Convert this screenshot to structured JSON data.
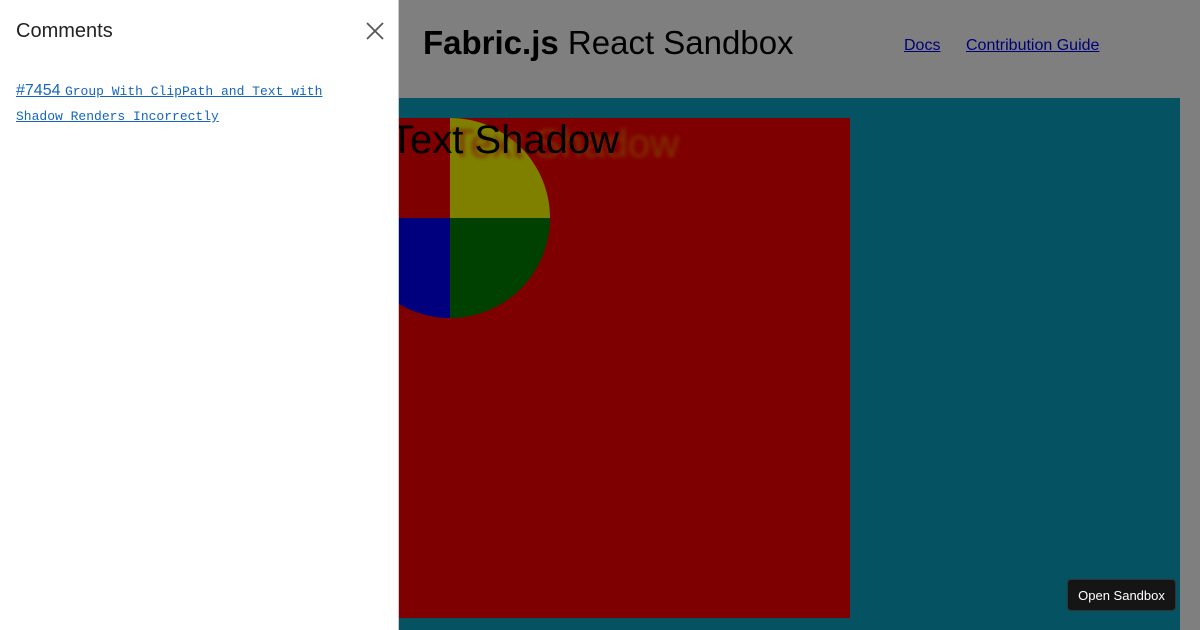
{
  "header": {
    "title_bold": "Fabric.js",
    "title_rest": "React Sandbox",
    "nav": [
      {
        "label": "Docs"
      },
      {
        "label": "Contribution Guide"
      }
    ]
  },
  "canvas": {
    "text": "Text Shadow",
    "colors": {
      "background": "#0aa5c6",
      "rect": "#ff0000",
      "pie_top_left": "#ff0000",
      "pie_top_right": "#ffff00",
      "pie_bottom_left": "#0000ff",
      "pie_bottom_right": "#008000",
      "shadow_text": "#ff6600"
    }
  },
  "comments_panel": {
    "title": "Comments",
    "close_icon": "close-icon",
    "items": [
      {
        "number": "#7454",
        "text": "Group With ClipPath and Text with Shadow Renders Incorrectly"
      }
    ]
  },
  "open_sandbox": {
    "label": "Open Sandbox"
  }
}
